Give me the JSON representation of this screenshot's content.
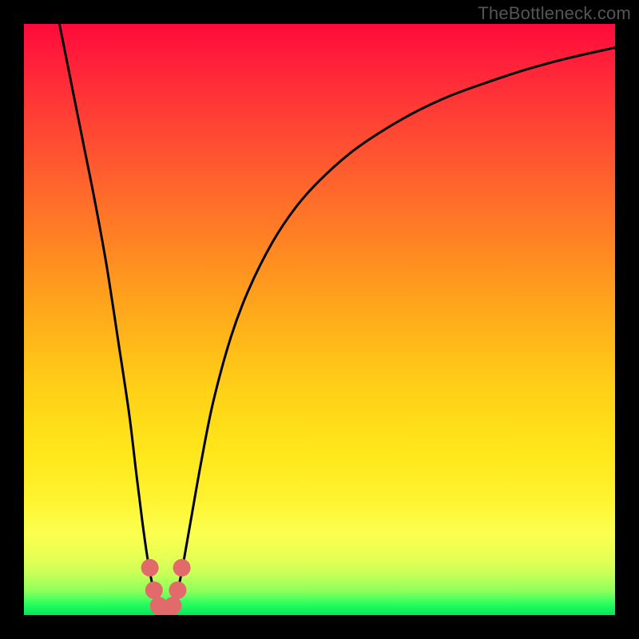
{
  "watermark": "TheBottleneck.com",
  "chart_data": {
    "type": "line",
    "title": "",
    "xlabel": "",
    "ylabel": "",
    "xlim": [
      0,
      100
    ],
    "ylim": [
      0,
      100
    ],
    "series": [
      {
        "name": "bottleneck-curve",
        "x": [
          6,
          8,
          10,
          12,
          14,
          16,
          17.8,
          19,
          20,
          21,
          22,
          23,
          23.6,
          24.4,
          25.2,
          26,
          27,
          28.4,
          30,
          32,
          35,
          38,
          42,
          46,
          50,
          55,
          60,
          66,
          72,
          78,
          85,
          92,
          100
        ],
        "y": [
          100,
          90,
          80,
          70,
          59,
          46,
          34,
          24,
          16,
          9,
          4,
          1.2,
          0.4,
          0.4,
          1.2,
          4,
          9,
          17,
          26,
          36,
          47,
          55,
          63,
          69,
          73.5,
          78,
          81.5,
          85,
          87.8,
          90,
          92.3,
          94.2,
          96
        ]
      }
    ],
    "markers": {
      "name": "highlight-dots",
      "color": "#e26a6a",
      "points": [
        {
          "x": 21.3,
          "y": 8.0
        },
        {
          "x": 22.0,
          "y": 4.2
        },
        {
          "x": 22.8,
          "y": 1.6
        },
        {
          "x": 23.6,
          "y": 0.6
        },
        {
          "x": 24.4,
          "y": 0.6
        },
        {
          "x": 25.2,
          "y": 1.6
        },
        {
          "x": 26.0,
          "y": 4.2
        },
        {
          "x": 26.7,
          "y": 8.0
        }
      ]
    },
    "gradient_stops": [
      {
        "pos": 0,
        "color": "#ff0a3a"
      },
      {
        "pos": 50,
        "color": "#ffb319"
      },
      {
        "pos": 80,
        "color": "#fff22e"
      },
      {
        "pos": 100,
        "color": "#00e85a"
      }
    ]
  }
}
